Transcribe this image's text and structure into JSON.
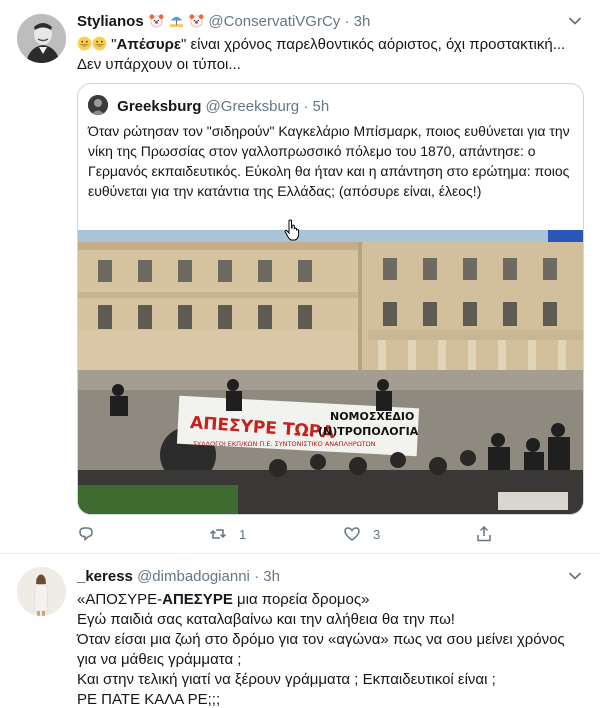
{
  "tweet1": {
    "author": "Stylianos",
    "handle": "@ConservatiVGrCy",
    "separator": "·",
    "time": "3h",
    "text_keyword": "Απέσυρε",
    "text_open_quote": "\"",
    "text_close_quote": "\"",
    "text_rest": " είναι χρόνος παρελθοντικός αόριστος, όχι προστακτική... Δεν υπάρχουν οι τύποι...",
    "quote": {
      "author": "Greeksburg",
      "handle": "@Greeksburg",
      "separator": "·",
      "time": "5h",
      "text": "Όταν ρώτησαν τον \"σιδηρούν\" Καγκελάριο Μπίσμαρκ, ποιος ευθύνεται για την νίκη της Πρωσσίας στον γαλλοπρωσσικό πόλεμο του 1870, απάντησε: ο Γερμανός εκπαιδευτικός. Εύκολη θα ήταν και η απάντηση στο ερώτημα: ποιος ευθύνεται για την κατάντια της Ελλάδας; (απόσυρε είναι, έλεος!)",
      "banner_left": "ΑΠΕΣΥΡΕ ΤΩΡΑ",
      "banner_right_1": "ΝΟΜΟΣΧΕΔΙΟ",
      "banner_right_2": "(Ν)ΤΡΟΠΟΛΟΓΙΑ",
      "banner_bottom": "ΣΥΛΛΟΓΟΙ ΕΚΠ/ΚΩΝ Π.Ε. ΣΥΝΤΟΝΙΣΤΙΚΟ ΑΝΑΠΛΗΡΩΤΩΝ"
    },
    "actions": {
      "reply_count": "",
      "retweet_count": "1",
      "like_count": "3"
    }
  },
  "tweet2": {
    "author": "_keress",
    "handle": "@dimbadogianni",
    "separator": "·",
    "time": "3h",
    "line1_prefix": "«ΑΠΟΣΥΡΕ-",
    "line1_bold": "ΑΠΕΣΥΡΕ",
    "line1_suffix": " μια πορεία δρομος»",
    "line2": "Εγώ παιδιά σας καταλαβαίνω και την αλήθεια θα την πω!",
    "line3": "Όταν είσαι μια ζωή στο δρόμο για τον «αγώνα» πως να σου μείνει χρόνος για να μάθεις γράμματα ;",
    "line4": "Και στην τελική γιατί να ξέρουν γράμματα ; Εκπαιδευτικοί είναι ;",
    "line5": "ΡΕ ΠΑΤΕ ΚΑΛΑ ΡΕ;;;"
  },
  "colors": {
    "text": "#14171a",
    "secondary": "#657786",
    "border": "#ccd6dd",
    "divider": "#e6ecf0"
  }
}
